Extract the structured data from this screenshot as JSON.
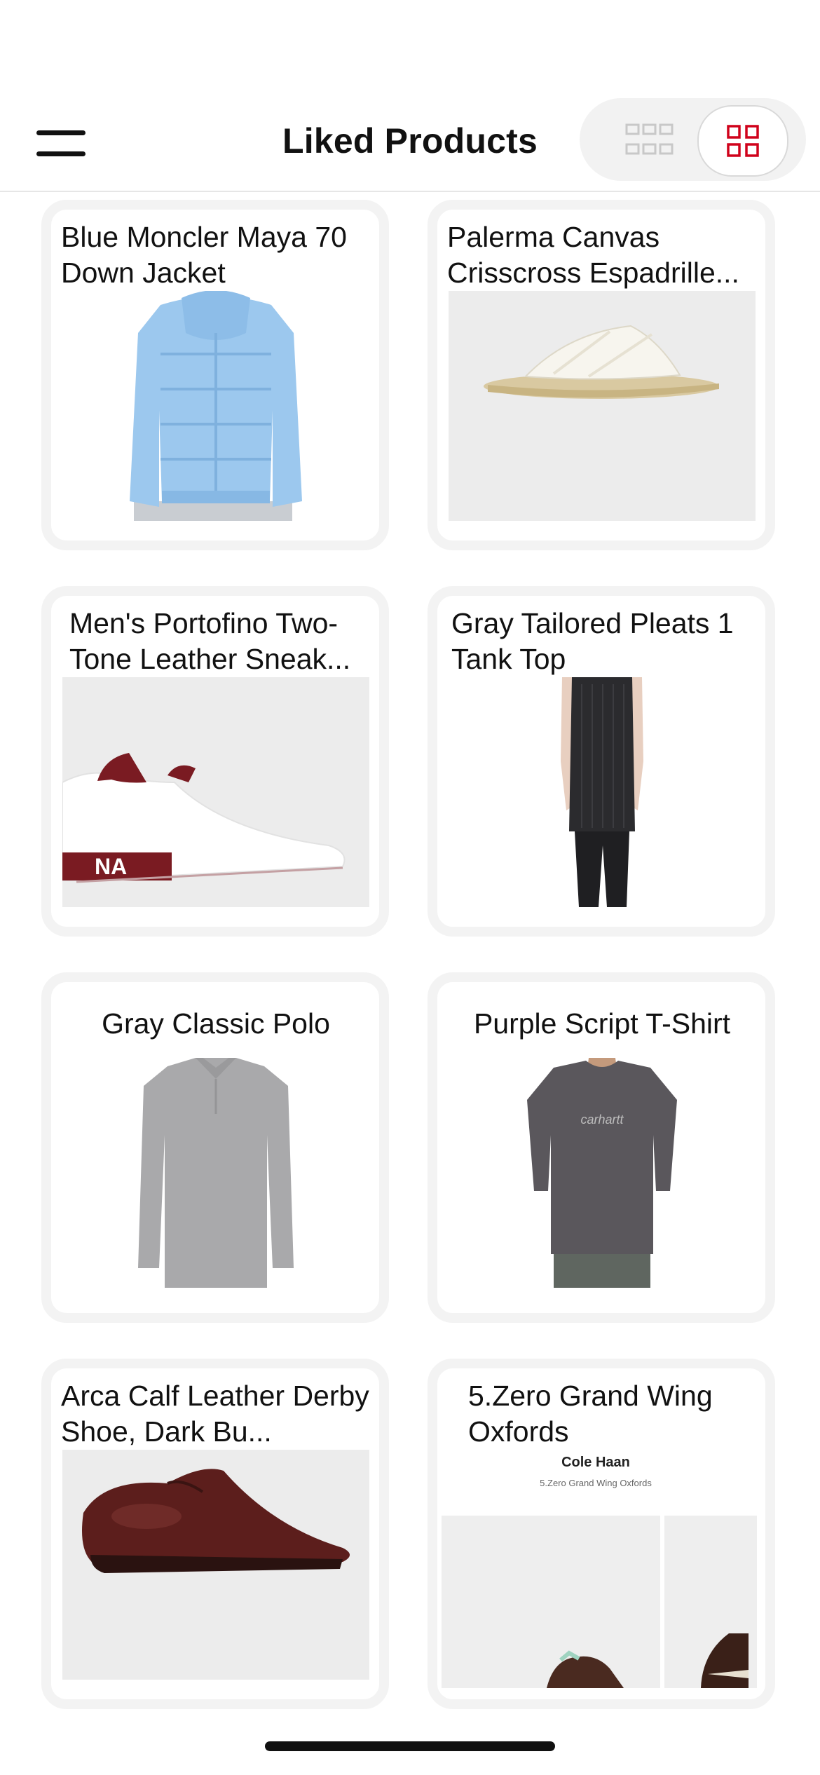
{
  "header": {
    "title": "Liked Products",
    "menu_icon": "hamburger-menu-icon",
    "view_toggle": {
      "list_icon": "list-view-icon",
      "grid_icon": "grid-view-icon",
      "selected": "grid",
      "accent_color": "#d0021b"
    }
  },
  "products": [
    {
      "title": "Blue Moncler Maya 70 Down Jacket",
      "image": "blue-puffer-jacket"
    },
    {
      "title": "Palerma Canvas Crisscross Espadrille...",
      "image": "white-espadrille-sandal"
    },
    {
      "title": "Men's Portofino Two-Tone Leather Sneak...",
      "image": "white-burgundy-sneaker",
      "image_text": "NA"
    },
    {
      "title": "Gray Tailored Pleats 1 Tank Top",
      "image": "black-pleated-tank-top"
    },
    {
      "title": "Gray Classic Polo",
      "image": "gray-long-sleeve-polo"
    },
    {
      "title": "Purple Script T-Shirt",
      "image": "purple-script-tshirt",
      "image_text": "carhartt"
    },
    {
      "title": "Arca Calf Leather Derby Shoe, Dark Bu...",
      "image": "burgundy-derby-shoe"
    },
    {
      "title": "5.Zero Grand Wing Oxfords",
      "image": "oxford-shoe-collage",
      "image_brand": "Cole Haan",
      "image_caption": "5.Zero Grand Wing Oxfords"
    }
  ]
}
